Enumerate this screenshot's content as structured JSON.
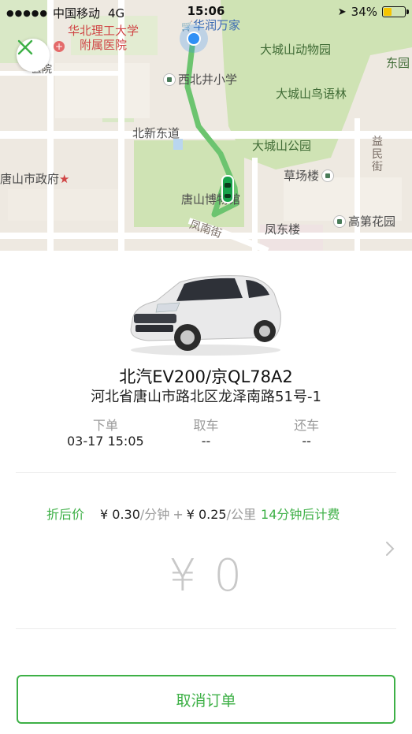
{
  "status_bar": {
    "carrier": "中国移动",
    "network": "4G",
    "time": "15:06",
    "battery_percent": "34%",
    "battery_level": 0.34
  },
  "map": {
    "labels": {
      "hospital": "华北理工大学\n附属医院",
      "huarun": "华润万家",
      "zoo": "大城山动物园",
      "dongyuan": "东园",
      "yiyuan_partial": "医院",
      "xibeijing_school": "西北井小学",
      "bird_forest": "大城山鸟语林",
      "beixin_road": "北新东道",
      "dachengshan_park": "大城山公园",
      "yimin_street": "益民街",
      "tangshan_gov": "唐山市政府",
      "tangshan_museum": "唐山博物馆",
      "caochang_lou": "草场楼",
      "fengnan_street": "凤南街",
      "gaodi_garden": "高第花园",
      "fengdong_lou": "凤东楼"
    }
  },
  "order": {
    "car_title": "北汽EV200/京QL78A2",
    "address": "河北省唐山市路北区龙泽南路51号-1",
    "steps": [
      {
        "label": "下单",
        "value": "03-17 15:05"
      },
      {
        "label": "取车",
        "value": "--"
      },
      {
        "label": "还车",
        "value": "--"
      }
    ],
    "price": {
      "discount_label": "折后价",
      "per_minute_value": "¥ 0.30",
      "per_minute_unit": "/分钟",
      "plus": "+",
      "per_km_value": "¥ 0.25",
      "per_km_unit": "/公里",
      "billing_note": "14分钟后计费"
    },
    "amount": "¥ 0",
    "cancel_label": "取消订单"
  },
  "colors": {
    "accent_green": "#3db046",
    "map_green": "#cfe3b4",
    "route": "#6cc46f",
    "location_blue": "#2f8ff5"
  }
}
